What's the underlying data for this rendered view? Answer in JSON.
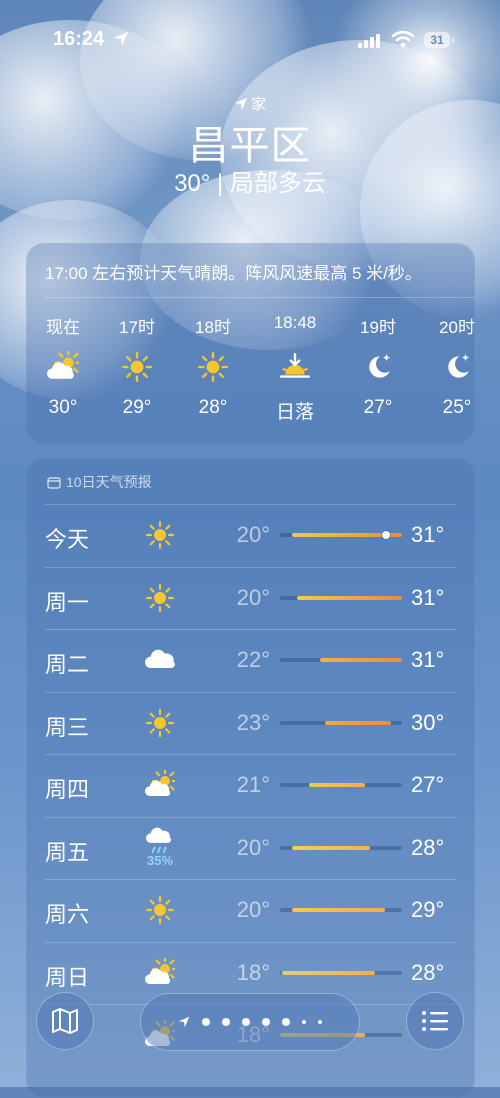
{
  "status_bar": {
    "time": "16:24",
    "battery": "31"
  },
  "header": {
    "home_label": "家",
    "city": "昌平区",
    "condition": "30° | 局部多云"
  },
  "hourly": {
    "summary": "17:00 左右预计天气晴朗。阵风风速最高 5 米/秒。",
    "items": [
      {
        "label": "现在",
        "icon": "partly-cloudy-icon",
        "temp": "30°"
      },
      {
        "label": "17时",
        "icon": "sun-icon",
        "temp": "29°"
      },
      {
        "label": "18时",
        "icon": "sun-icon",
        "temp": "28°"
      },
      {
        "label": "18:48",
        "icon": "sunset-icon",
        "temp": "日落"
      },
      {
        "label": "19时",
        "icon": "moon-icon",
        "temp": "27°"
      },
      {
        "label": "20时",
        "icon": "moon-icon",
        "temp": "25°"
      }
    ]
  },
  "daily": {
    "title": "10日天气预报",
    "items": [
      {
        "day": "今天",
        "icon": "sun-icon",
        "low": "20°",
        "high": "31°",
        "bar_start": 0.1,
        "bar_end": 1.0,
        "current": 0.87,
        "c1": "#f2c94c",
        "c2": "#f08a3c"
      },
      {
        "day": "周一",
        "icon": "sun-icon",
        "low": "20°",
        "high": "31°",
        "bar_start": 0.14,
        "bar_end": 1.0,
        "c1": "#f2c94c",
        "c2": "#f08a3c"
      },
      {
        "day": "周二",
        "icon": "cloud-icon",
        "low": "22°",
        "high": "31°",
        "bar_start": 0.33,
        "bar_end": 1.0,
        "c1": "#f3b04a",
        "c2": "#f08a3c"
      },
      {
        "day": "周三",
        "icon": "sun-icon",
        "low": "23°",
        "high": "30°",
        "bar_start": 0.37,
        "bar_end": 0.91,
        "c1": "#f3a545",
        "c2": "#f08a3c"
      },
      {
        "day": "周四",
        "icon": "partly-cloudy-icon",
        "low": "21°",
        "high": "27°",
        "bar_start": 0.24,
        "bar_end": 0.7,
        "c1": "#f2c94c",
        "c2": "#f2b04a"
      },
      {
        "day": "周五",
        "icon": "rain-cloud-icon",
        "pop": "35%",
        "low": "20°",
        "high": "28°",
        "bar_start": 0.1,
        "bar_end": 0.74,
        "c1": "#f2d04c",
        "c2": "#f2b44a"
      },
      {
        "day": "周六",
        "icon": "sun-icon",
        "low": "20°",
        "high": "29°",
        "bar_start": 0.1,
        "bar_end": 0.86,
        "c1": "#f2c94c",
        "c2": "#f2ae4a"
      },
      {
        "day": "周日",
        "icon": "partly-cloudy-icon",
        "low": "18°",
        "high": "28°",
        "bar_start": 0.02,
        "bar_end": 0.78,
        "c1": "#d8d27a",
        "c2": "#f2b04a"
      },
      {
        "day": "",
        "icon": "partly-cloudy-icon",
        "low": "18°",
        "high": "",
        "bar_start": 0.0,
        "bar_end": 0.7,
        "c1": "#d8d27a",
        "c2": "#f2b04a"
      }
    ]
  }
}
